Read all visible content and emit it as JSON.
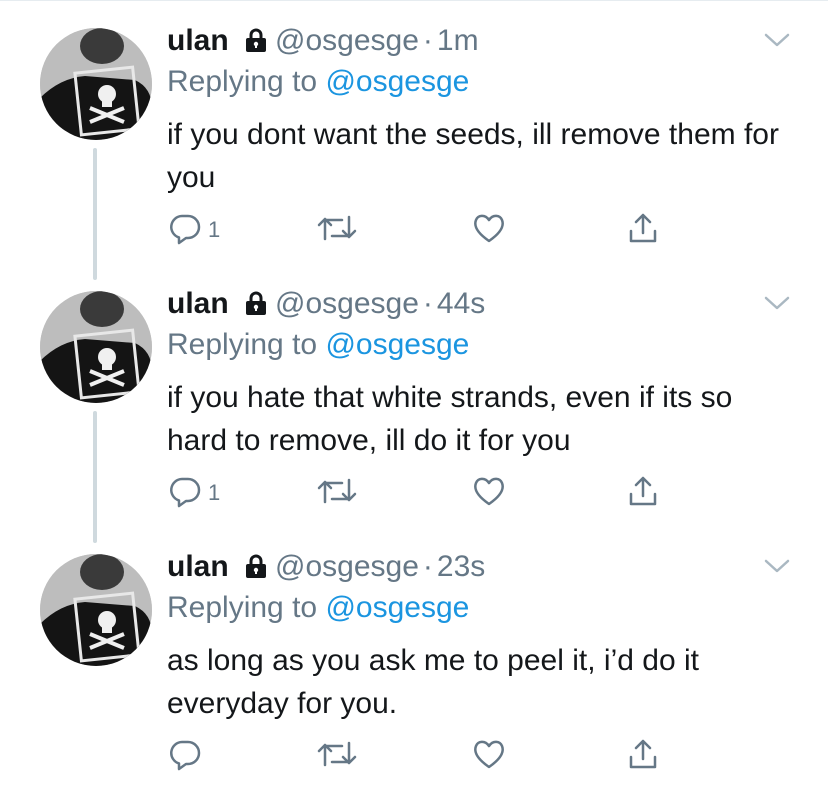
{
  "tweets": [
    {
      "name": "ulan",
      "handle": "@osgesge",
      "separator": "·",
      "time": "1m",
      "replying_prefix": "Replying to",
      "replying_to": "@osgesge",
      "text": "if you dont want the seeds, ill remove them for you",
      "reply_count": "1"
    },
    {
      "name": "ulan",
      "handle": "@osgesge",
      "separator": "·",
      "time": "44s",
      "replying_prefix": "Replying to",
      "replying_to": "@osgesge",
      "text": "if you hate that white strands, even if its so hard to remove, ill do it for you",
      "reply_count": "1"
    },
    {
      "name": "ulan",
      "handle": "@osgesge",
      "separator": "·",
      "time": "23s",
      "replying_prefix": "Replying to",
      "replying_to": "@osgesge",
      "text": "as long as you ask me to peel it, i’d do it everyday for you.",
      "reply_count": ""
    }
  ],
  "icons": {
    "lock": "lock-icon",
    "chevron": "chevron-down-icon",
    "reply": "reply-icon",
    "retweet": "retweet-icon",
    "like": "heart-icon",
    "share": "share-icon"
  },
  "colors": {
    "text": "#14171a",
    "secondary": "#657786",
    "link": "#1b95e0",
    "thread_line": "#cfd9de"
  }
}
